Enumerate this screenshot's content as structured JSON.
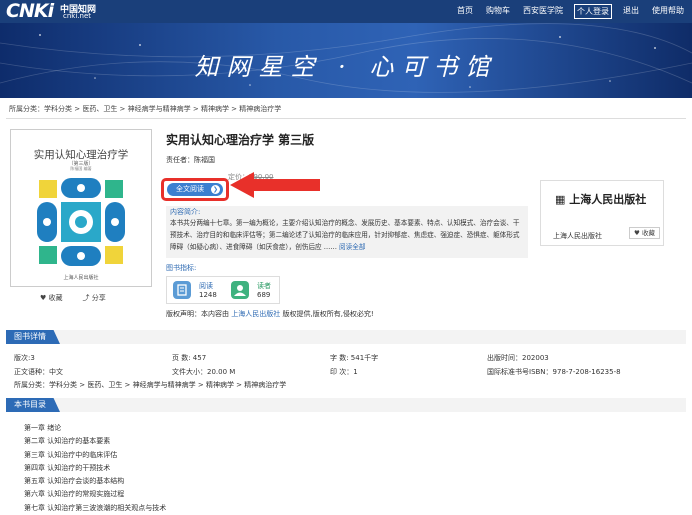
{
  "header": {
    "logo_text": "CNKi",
    "logo_cn": "中国知网",
    "logo_domain": "cnki.net",
    "nav": [
      "首页",
      "购物车",
      "西安医学院",
      "个人登录",
      "退出",
      "使用帮助"
    ]
  },
  "banner": {
    "slogan": "知网星空 · 心可书馆"
  },
  "breadcrumb": "所属分类：学科分类 > 医药、卫生 > 神经病学与精神病学 > 精神病学 > 精神病治疗学",
  "cover": {
    "title": "实用认知心理治疗学",
    "subtitle": "（第三版）",
    "author": "陈福国 编著",
    "publisher": "上海人民出版社",
    "favorite_label": "收藏",
    "share_label": "分享"
  },
  "book": {
    "title": "实用认知心理治疗学 第三版",
    "author_line": "责任者：陈福国",
    "price_label": "定价：",
    "price_value": "¥90.00",
    "read_button": "全文阅读",
    "intro_label": "内容简介:",
    "intro_text": "本书共分两编十七章。第一编为概论，主要介绍认知治疗的概念、发展历史、基本要素、特点、认知模式、治疗会谈、干预技术、治疗目的和临床评估等；第二编论述了认知治疗的临床应用，针对抑郁症、焦虑症、强迫症、恐惧症、躯体形式障碍（如疑心病）、进食障碍（如厌食症），创伤后应 ……",
    "intro_more": "阅读全部",
    "metrics_label": "图书指标:",
    "metrics": [
      {
        "label": "阅读",
        "value": "1248"
      },
      {
        "label": "读者",
        "value": "689"
      }
    ],
    "copyright_prefix": "版权声明：本内容由",
    "copyright_link": "上海人民出版社",
    "copyright_suffix": "版权提供,版权所有,侵权必究!"
  },
  "publisher_box": {
    "logo": "上海人民出版社",
    "name": "上海人民出版社",
    "favorite": "收藏"
  },
  "details": {
    "section_title": "图书详情",
    "edition": "版次:3",
    "pages": "页 数: 457",
    "words": "字 数: 541千字",
    "pub_time": "出版时间：202003",
    "language": "正文语种：中文",
    "file_size": "文件大小：20.00 M",
    "print_count": "印 次：1",
    "isbn": "国际标准书号ISBN：978-7-208-16235-8",
    "category": "所属分类：学科分类 > 医药、卫生 > 神经病学与精神病学 > 精神病学 > 精神病治疗学"
  },
  "toc": {
    "section_title": "本书目录",
    "items": [
      "第一章  绪论",
      "第二章  认知治疗的基本要素",
      "第三章  认知治疗中的临床评估",
      "第四章  认知治疗的干预技术",
      "第五章  认知治疗会谈的基本结构",
      "第六章  认知治疗的常规实施过程",
      "第七章  认知治疗第三波浪潮的相关观点与技术"
    ]
  },
  "colors": {
    "header_bg": "#1a3f7a",
    "accent_blue": "#2d6bb6",
    "highlight_red": "#e8302a"
  }
}
